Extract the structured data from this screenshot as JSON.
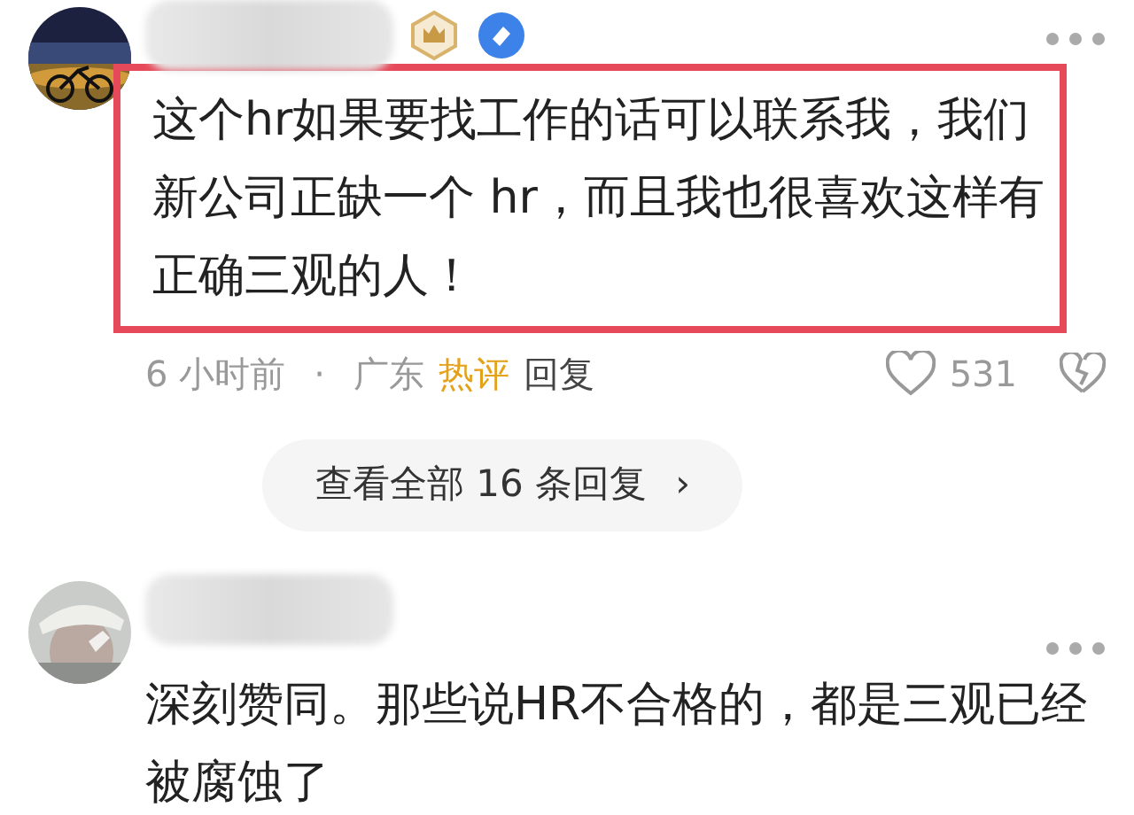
{
  "comments": [
    {
      "highlighted": true,
      "text": "这个hr如果要找工作的话可以联系我，我们新公司正缺一个 hr，而且我也很喜欢这样有正确三观的人！",
      "meta": {
        "time": "6 小时前",
        "dot": "·",
        "location": "广东",
        "tag": "热评",
        "reply": "回复"
      },
      "likes": "531",
      "more_replies": {
        "label": "查看全部 16 条回复",
        "arrow": "›"
      }
    },
    {
      "highlighted": false,
      "text": "深刻赞同。那些说HR不合格的，都是三观已经被腐蚀了"
    }
  ]
}
